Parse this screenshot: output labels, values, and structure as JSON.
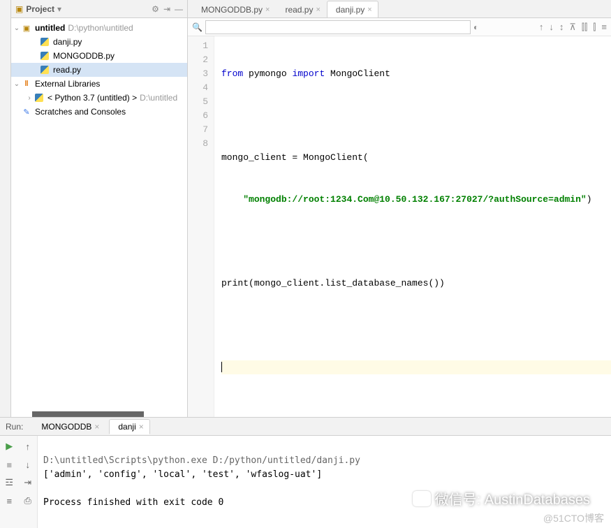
{
  "sidebar": {
    "title": "Project",
    "root": {
      "name": "untitled",
      "path": "D:\\python\\untitled"
    },
    "files": [
      "danji.py",
      "MONGODDB.py",
      "read.py"
    ],
    "selected_file": "read.py",
    "external": "External Libraries",
    "python_env": "< Python 3.7 (untitled) >",
    "python_path": "D:\\untitled",
    "scratches": "Scratches and Consoles"
  },
  "tabs": [
    {
      "label": "MONGODDB.py",
      "active": false
    },
    {
      "label": "read.py",
      "active": false
    },
    {
      "label": "danji.py",
      "active": true
    }
  ],
  "search": {
    "placeholder": ""
  },
  "code": {
    "lines": [
      1,
      2,
      3,
      4,
      5,
      6,
      7,
      8
    ],
    "l1_kw1": "from",
    "l1_mod": " pymongo ",
    "l1_kw2": "import",
    "l1_cls": " MongoClient",
    "l3_a": "mongo_client = MongoClient(",
    "l4_pad": "    ",
    "l4_str": "\"mongodb://root:1234.Com@10.50.132.167:27027/?authSource=admin\"",
    "l4_b": ")",
    "l6_a": "print",
    "l6_b": "(mongo_client.list_database_names())"
  },
  "run": {
    "label": "Run:",
    "tabs": [
      {
        "label": "MONGODDB",
        "active": false
      },
      {
        "label": "danji",
        "active": true
      }
    ],
    "output": {
      "cmd": "D:\\untitled\\Scripts\\python.exe D:/python/untitled/danji.py",
      "result": "['admin', 'config', 'local', 'test', 'wfaslog-uat']",
      "exit": "Process finished with exit code 0"
    }
  },
  "watermark": {
    "text": "微信号: AustinDatabases",
    "credit": "@51CTO博客"
  }
}
